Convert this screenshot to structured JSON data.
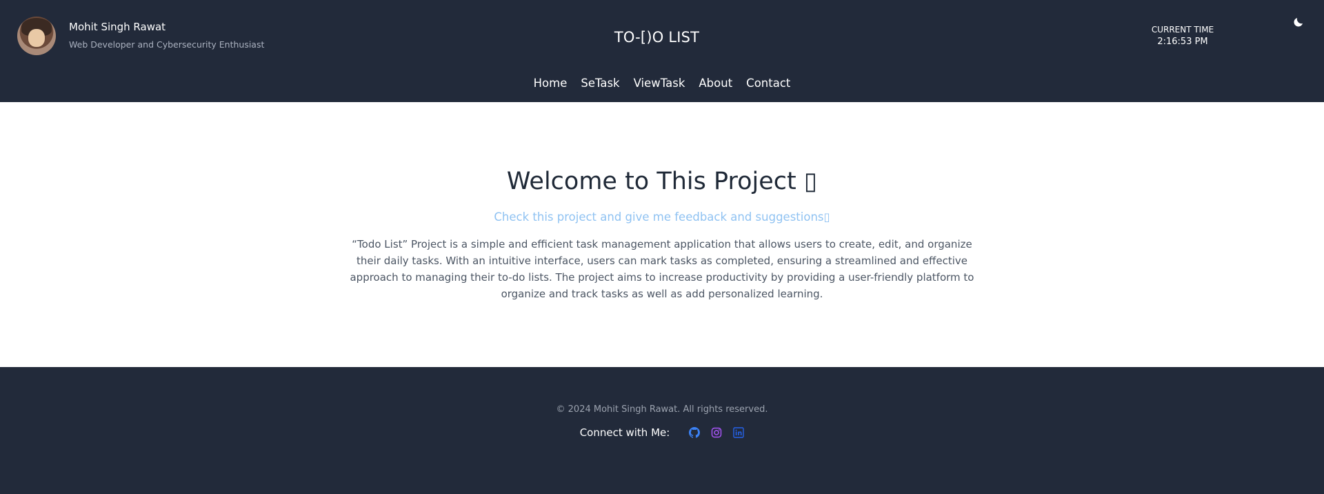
{
  "header": {
    "profile_name": "Mohit Singh Rawat",
    "profile_role": "Web Developer and Cybersecurity Enthusiast",
    "site_title": "TO-[)O LIST",
    "time_label": "CURRENT TIME",
    "time_value": "2:16:53 PM",
    "theme_icon": "moon-icon"
  },
  "nav": {
    "items": [
      {
        "label": "Home"
      },
      {
        "label": "SeTask"
      },
      {
        "label": "ViewTask"
      },
      {
        "label": "About"
      },
      {
        "label": "Contact"
      }
    ]
  },
  "main": {
    "welcome": "Welcome to This Project ▯",
    "subtitle": "Check this project and give me feedback and suggestions▯",
    "description": "“Todo List” Project is a simple and efficient task management application that allows users to create, edit, and organize their daily tasks. With an intuitive interface, users can mark tasks as completed, ensuring a streamlined and effective approach to managing their to-do lists. The project aims to increase productivity by providing a user-friendly platform to organize and track tasks as well as add personalized learning."
  },
  "footer": {
    "copyright": "© 2024 Mohit Singh Rawat. All rights reserved.",
    "connect_label": "Connect with Me:",
    "social": [
      {
        "icon": "github-icon",
        "color": "#3b82f6"
      },
      {
        "icon": "instagram-icon",
        "color": "#a855f7"
      },
      {
        "icon": "linkedin-icon",
        "color": "#2563eb"
      }
    ]
  },
  "colors": {
    "header_bg": "#222a3a",
    "subtitle": "#8fc2f2",
    "body_text": "#4b5563"
  }
}
